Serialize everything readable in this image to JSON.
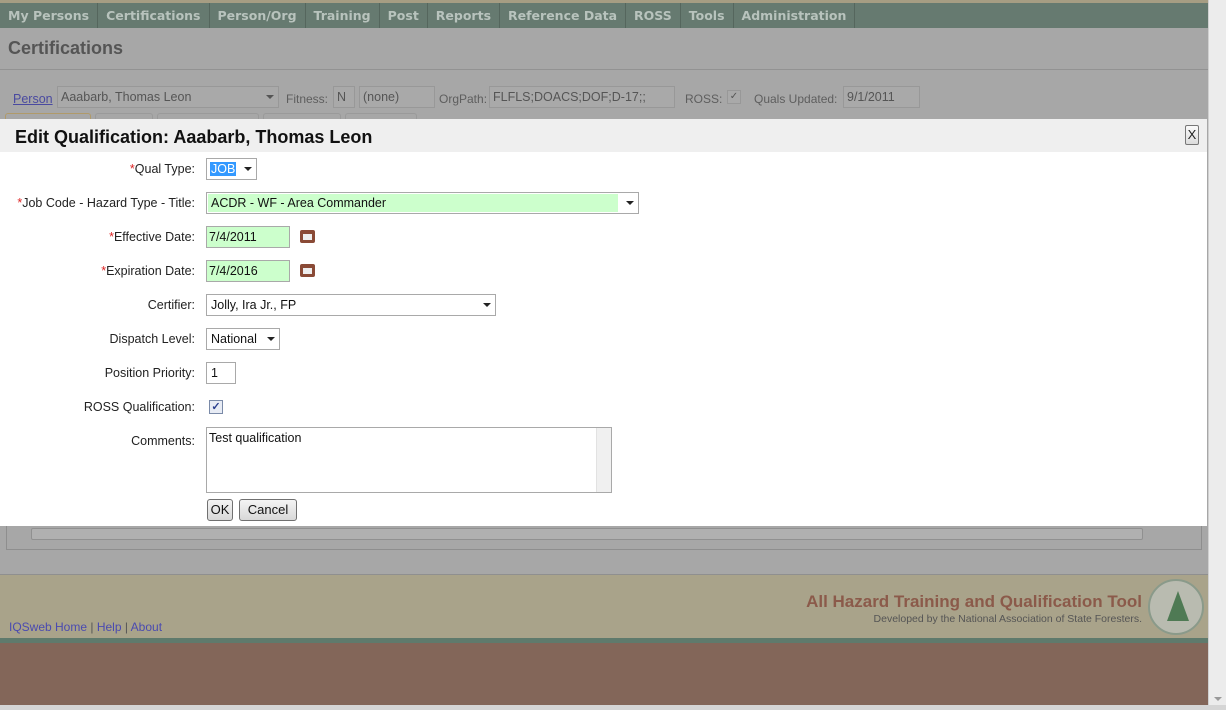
{
  "nav": {
    "items": [
      "My Persons",
      "Certifications",
      "Person/Org",
      "Training",
      "Post",
      "Reports",
      "Reference Data",
      "ROSS",
      "Tools",
      "Administration"
    ]
  },
  "page": {
    "title": "Certifications"
  },
  "person_bar": {
    "person_link": "Person",
    "person_value": "Aaabarb, Thomas Leon",
    "fitness_label": "Fitness:",
    "fitness_value": "N",
    "fitness_extra": "(none)",
    "orgpath_label": "OrgPath:",
    "orgpath_value": "FLFLS;DOACS;DOF;D-17;;",
    "ross_label": "ROSS:",
    "ross_checked": true,
    "quals_updated_label": "Quals Updated:",
    "quals_updated_value": "9/1/2011"
  },
  "modal": {
    "title": "Edit Qualification: Aaabarb, Thomas Leon",
    "close_label": "X",
    "required_marker": "*",
    "fields": {
      "qual_type": {
        "label": "Qual Type:",
        "value": "JOB",
        "required": true
      },
      "job_code": {
        "label": "Job Code - Hazard Type - Title:",
        "value": "ACDR - WF - Area Commander",
        "required": true
      },
      "effective_date": {
        "label": "Effective Date:",
        "value": "7/4/2011",
        "required": true
      },
      "expiration_date": {
        "label": "Expiration Date:",
        "value": "7/4/2016",
        "required": true
      },
      "certifier": {
        "label": "Certifier:",
        "value": "Jolly, Ira Jr., FP"
      },
      "dispatch_level": {
        "label": "Dispatch Level:",
        "value": "National"
      },
      "position_priority": {
        "label": "Position Priority:",
        "value": "1"
      },
      "ross_qualification": {
        "label": "ROSS Qualification:",
        "checked": true
      },
      "comments": {
        "label": "Comments:",
        "value": "Test qualification"
      }
    },
    "ok_label": "OK",
    "cancel_label": "Cancel"
  },
  "footer": {
    "links": [
      "IQSweb Home",
      "Help",
      "About"
    ],
    "separator": "|",
    "app_title": "All Hazard Training and Qualification Tool",
    "app_subtitle": "Developed by the National Association of State Foresters."
  },
  "colors": {
    "nav_bg": "#667a70",
    "required_field_bg": "#ccffcc",
    "footer_title": "#8b5a4a",
    "link": "#4a4ab0"
  }
}
